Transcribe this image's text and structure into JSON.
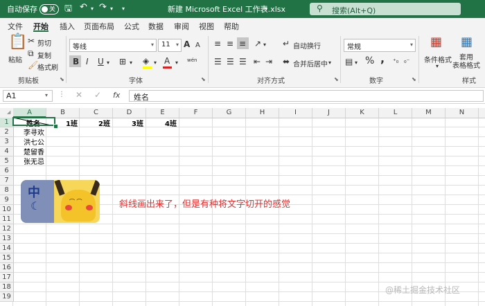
{
  "titlebar": {
    "autosave_label": "自动保存",
    "toggle_state": "关",
    "title": "新建 Microsoft Excel 工作表.xlsx",
    "search_placeholder": "搜索(Alt+Q)"
  },
  "menu": {
    "tabs": [
      "文件",
      "开始",
      "插入",
      "页面布局",
      "公式",
      "数据",
      "审阅",
      "视图",
      "帮助"
    ],
    "active": "开始"
  },
  "ribbon": {
    "clipboard": {
      "paste": "粘贴",
      "cut": "剪切",
      "copy": "复制",
      "format_painter": "格式刷",
      "group": "剪贴板"
    },
    "font": {
      "name": "等线",
      "size": "11",
      "bold": "B",
      "italic": "I",
      "underline": "U",
      "font_size_up": "A",
      "font_size_down": "A",
      "phonetic": "wén",
      "group": "字体"
    },
    "alignment": {
      "wrap_text": "自动换行",
      "merge_center": "合并后居中",
      "group": "对齐方式"
    },
    "number": {
      "format": "常规",
      "percent": "%",
      "comma": ",",
      "group": "数字"
    },
    "styles": {
      "conditional": "条件格式",
      "table_format": "套用\n表格格式",
      "group": "样式"
    }
  },
  "formula_bar": {
    "name_box": "A1",
    "fx": "fx",
    "content": "姓名"
  },
  "sheet": {
    "columns": [
      "A",
      "B",
      "C",
      "D",
      "E",
      "F",
      "G",
      "H",
      "I",
      "J",
      "K",
      "L",
      "M",
      "N"
    ],
    "rows": [
      "1",
      "2",
      "3",
      "4",
      "5",
      "6",
      "7",
      "8",
      "9",
      "10",
      "11",
      "12",
      "13",
      "14",
      "15",
      "16",
      "17",
      "18",
      "19"
    ],
    "header_row": [
      "姓名",
      "1班",
      "2班",
      "3班",
      "4班"
    ],
    "names": [
      "李寻欢",
      "洪七公",
      "楚留香",
      "张无忌"
    ]
  },
  "annotation": "斜线画出来了，但是有种将文字切开的感觉",
  "sticker": {
    "character": "中"
  },
  "watermark": "@稀土掘金技术社区",
  "colors": {
    "brand": "#217346",
    "annotation": "#e03030"
  }
}
